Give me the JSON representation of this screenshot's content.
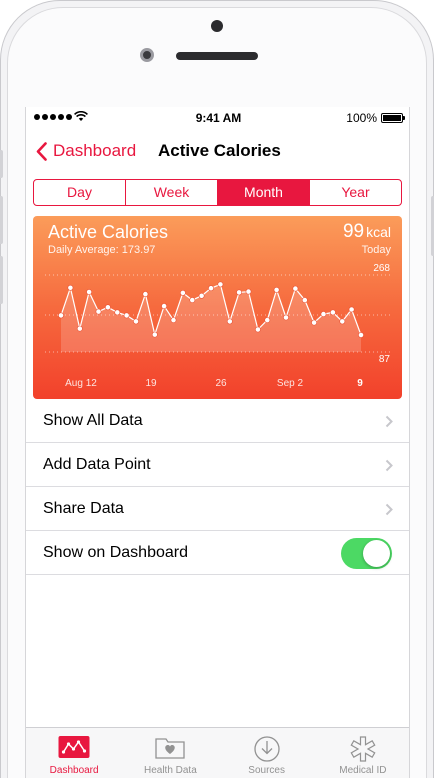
{
  "status": {
    "time": "9:41 AM",
    "battery": "100%"
  },
  "nav": {
    "back_label": "Dashboard",
    "title": "Active Calories"
  },
  "segments": [
    "Day",
    "Week",
    "Month",
    "Year"
  ],
  "active_segment": "Month",
  "card": {
    "title": "Active Calories",
    "subtitle": "Daily Average: 173.97",
    "value": "99",
    "unit": "kcal",
    "period": "Today",
    "y_max_label": "268",
    "y_min_label": "87",
    "x_labels": [
      "Aug 12",
      "19",
      "26",
      "Sep 2",
      "9"
    ]
  },
  "chart_data": {
    "type": "line",
    "title": "Active Calories",
    "ylim": [
      87,
      268
    ],
    "average": 173.97,
    "x_tick_labels": [
      "Aug 12",
      "19",
      "26",
      "Sep 2",
      "9"
    ],
    "values": [
      173,
      238,
      142,
      228,
      182,
      192,
      180,
      173,
      159,
      223,
      128,
      195,
      162,
      226,
      209,
      219,
      237,
      246,
      159,
      227,
      229,
      140,
      162,
      233,
      168,
      236,
      209,
      156,
      176,
      180,
      159,
      187,
      127
    ],
    "colors": {
      "card_top": "#fb9c5a",
      "card_bottom": "#f2412b",
      "line": "#ffffff"
    }
  },
  "list": {
    "show_all": "Show All Data",
    "add_point": "Add Data Point",
    "share": "Share Data",
    "show_dashboard": "Show on Dashboard",
    "show_dashboard_on": true
  },
  "tabs": [
    {
      "label": "Dashboard",
      "icon": "dashboard-chart-icon",
      "active": true
    },
    {
      "label": "Health Data",
      "icon": "health-folder-icon",
      "active": false
    },
    {
      "label": "Sources",
      "icon": "sources-download-icon",
      "active": false
    },
    {
      "label": "Medical ID",
      "icon": "medical-asterisk-icon",
      "active": false
    }
  ],
  "accent": "#e8173f",
  "toggle_color": "#4cd964"
}
